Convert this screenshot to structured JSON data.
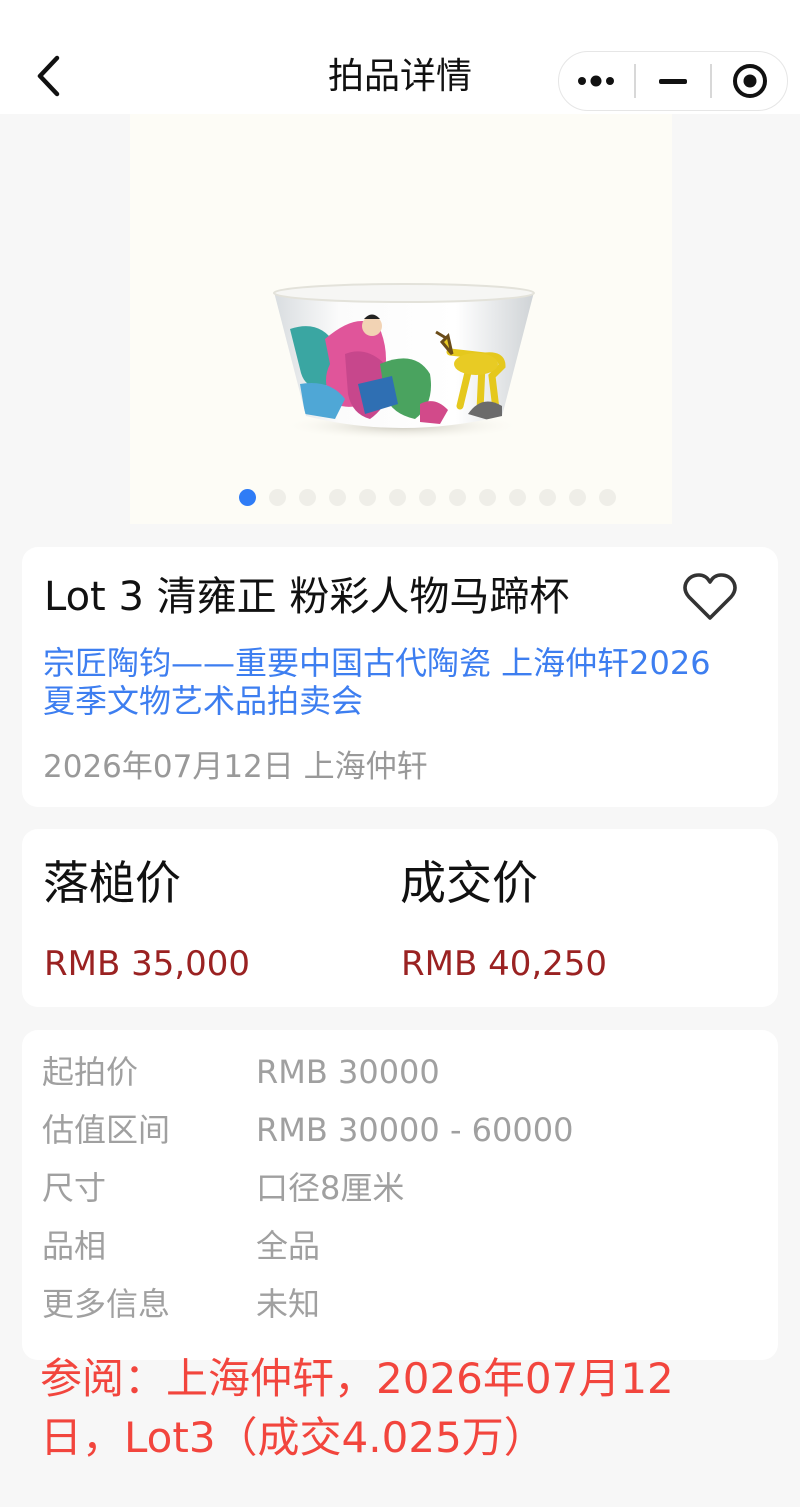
{
  "nav": {
    "title": "拍品详情",
    "back_icon": "chevron-left-icon",
    "capsule": {
      "more_icon": "more-dots-icon",
      "minimize_icon": "minimize-icon",
      "close_icon": "target-close-icon"
    }
  },
  "gallery": {
    "image_description": "famille rose porcelain cup with figure and deer",
    "slide_count": 13,
    "active_index": 0,
    "active_dot_color": "#2f7cf6"
  },
  "lot": {
    "title": "Lot 3 清雍正 粉彩人物马蹄杯",
    "favorite_icon": "heart-outline-icon",
    "auction_line1": "宗匠陶钧——重要中国古代陶瓷 上海仲轩2026",
    "auction_line2": "夏季文物艺术品拍卖会",
    "date_location": "2026年07月12日 上海仲轩"
  },
  "prices": {
    "hammer_label": "落槌价",
    "hammer_value": "RMB 35,000",
    "deal_label": "成交价",
    "deal_value": "RMB 40,250",
    "value_color": "#9a2222"
  },
  "details": [
    {
      "label": "起拍价",
      "value": "RMB 30000"
    },
    {
      "label": "估值区间",
      "value": "RMB 30000 - 60000"
    },
    {
      "label": "尺寸",
      "value": "口径8厘米"
    },
    {
      "label": "品相",
      "value": "全品"
    },
    {
      "label": "更多信息",
      "value": "未知"
    }
  ],
  "note": {
    "line1": "参阅：上海仲轩，2026年07月12",
    "line2": "日，Lot3（成交4.025万）",
    "color": "#f2453d"
  }
}
